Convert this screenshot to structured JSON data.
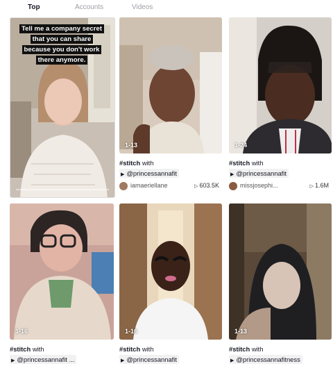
{
  "tabs": [
    {
      "label": "Top",
      "active": true
    },
    {
      "label": "Accounts",
      "active": false
    },
    {
      "label": "Videos",
      "active": false
    }
  ],
  "videos": [
    {
      "overlay_text": "Tell me a company secret that you can share because you don't work there anymore.",
      "progress": 0.0
    },
    {
      "counter": "1-13",
      "caption_tag": "#stitch",
      "caption_rest": " with",
      "mention": "@princessannafit",
      "username": "iamaeriellane",
      "views": "603.5K"
    },
    {
      "counter": "1-24",
      "caption_tag": "#stitch",
      "caption_rest": " with",
      "mention": "@princessannafit",
      "username": "missjosephi...",
      "views": "1.6M"
    },
    {
      "counter": "1-16",
      "caption_tag": "#stitch",
      "caption_rest": " with",
      "mention": "@princessannafit ..."
    },
    {
      "counter": "1-16",
      "caption_tag": "#stitch",
      "caption_rest": " with",
      "mention": "@princessannafit"
    },
    {
      "counter": "1-13",
      "caption_tag": "#stitch",
      "caption_rest": " with",
      "mention": "@princessannafitness"
    }
  ],
  "colors": {
    "text": "#161823",
    "tab_inactive": "#9ea0a6",
    "mention_bg": "#f1f1f2"
  },
  "icons": [
    "play-icon",
    "mention-arrow-icon",
    "avatar"
  ]
}
